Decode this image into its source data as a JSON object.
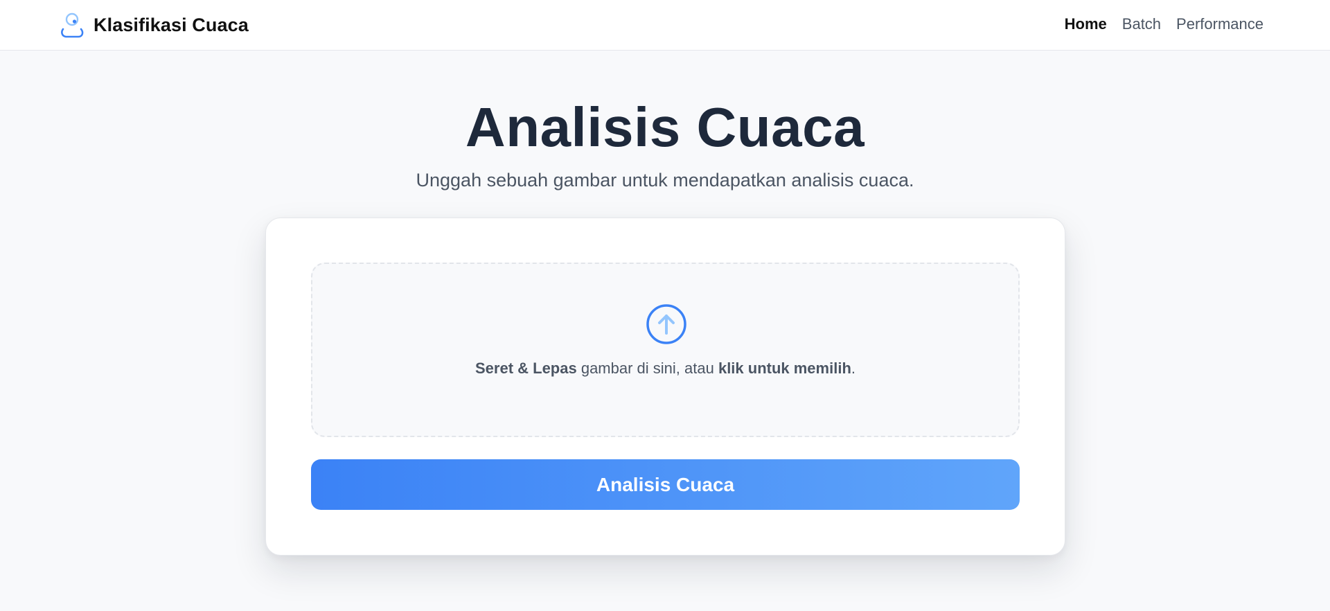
{
  "header": {
    "brand_name": "Klasifikasi Cuaca",
    "logo_icon": "cloud-sun-icon",
    "nav": [
      {
        "label": "Home",
        "active": true
      },
      {
        "label": "Batch",
        "active": false
      },
      {
        "label": "Performance",
        "active": false
      }
    ]
  },
  "main": {
    "title": "Analisis Cuaca",
    "subtitle": "Unggah sebuah gambar untuk mendapatkan analisis cuaca.",
    "dropzone": {
      "icon": "upload-arrow-icon",
      "bold_1": "Seret & Lepas",
      "text_1": " gambar di sini, atau ",
      "bold_2": "klik untuk memilih",
      "text_2": "."
    },
    "analyze_button_label": "Analisis Cuaca"
  },
  "colors": {
    "accent": "#3b82f6",
    "accent_light": "#60a5fa",
    "title": "#1e293b",
    "background": "#f8f9fb"
  }
}
